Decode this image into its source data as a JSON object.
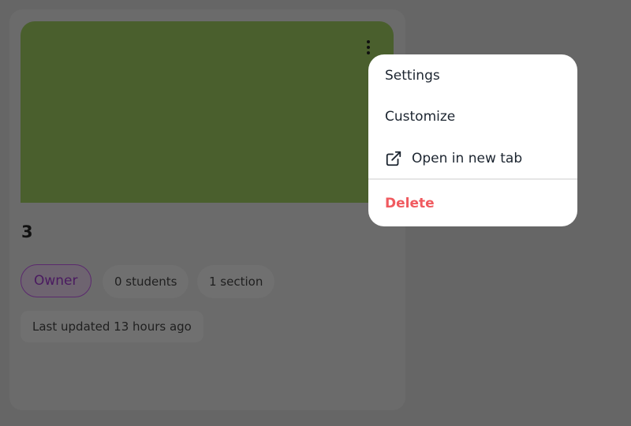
{
  "card": {
    "title": "3",
    "banner_color": "#4a5f2d",
    "more_menu_icon": "kebab-vertical-icon",
    "chips": {
      "role": "Owner",
      "students": "0 students",
      "sections": "1 section",
      "last_updated": "Last updated 13 hours ago"
    }
  },
  "context_menu": {
    "settings": "Settings",
    "customize": "Customize",
    "open_new_tab": "Open in new tab",
    "open_new_tab_icon": "external-link-icon",
    "delete": "Delete",
    "delete_color": "#f05a5f"
  }
}
